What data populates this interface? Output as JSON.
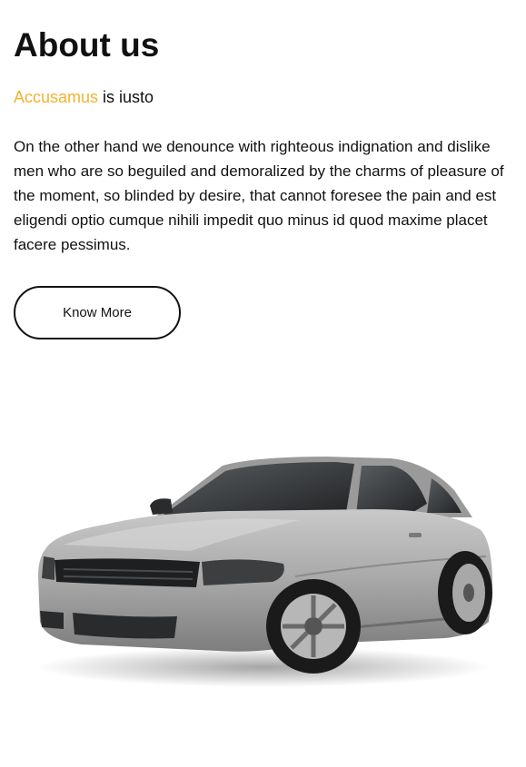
{
  "about": {
    "title": "About us",
    "subtitle_accent": "Accusamus",
    "subtitle_rest": " is iusto",
    "body": "On the other hand we denounce with righteous indignation and dislike men who are so beguiled and demoralized by the charms of pleasure of the moment, so blinded by desire, that cannot foresee the pain and est eligendi optio cumque nihili impedit quo minus id quod maxime placet facere pessimus.",
    "button_label": "Know More"
  },
  "colors": {
    "accent": "#f5b12e",
    "text": "#111111",
    "car_body": "#a9a9a9"
  },
  "image": {
    "icon": "car-image"
  }
}
